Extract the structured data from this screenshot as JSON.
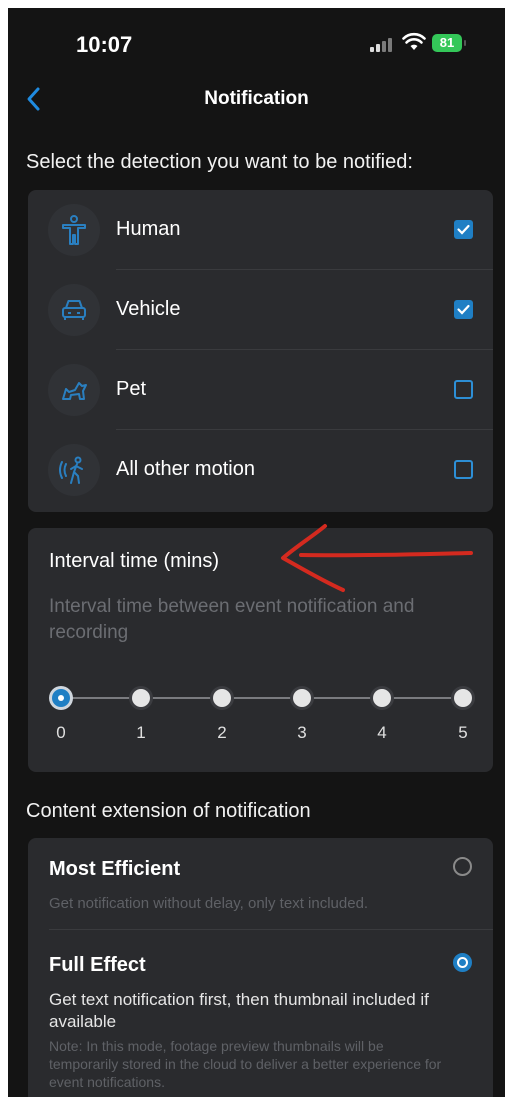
{
  "status_bar": {
    "time": "10:07",
    "battery": "81"
  },
  "nav": {
    "title": "Notification"
  },
  "detection": {
    "heading": "Select the detection you want to be notified:",
    "items": [
      {
        "label": "Human",
        "checked": true,
        "icon": "person-icon"
      },
      {
        "label": "Vehicle",
        "checked": true,
        "icon": "car-icon"
      },
      {
        "label": "Pet",
        "checked": false,
        "icon": "pet-icon"
      },
      {
        "label": "All other motion",
        "checked": false,
        "icon": "motion-icon"
      }
    ]
  },
  "interval": {
    "title": "Interval time (mins)",
    "description": "Interval time between event notification and recording",
    "options": [
      "0",
      "1",
      "2",
      "3",
      "4",
      "5"
    ],
    "selected": "0"
  },
  "content_extension": {
    "heading": "Content extension of notification",
    "options": [
      {
        "title": "Most Efficient",
        "description": "Get notification without delay, only text included.",
        "selected": false
      },
      {
        "title": "Full Effect",
        "description": "Get text notification first, then thumbnail included if available",
        "note": "Note: In this mode, footage preview thumbnails will be temporarily stored in the cloud to deliver a better experience for event notifications.",
        "selected": true
      }
    ]
  },
  "colors": {
    "accent": "#1f7fc4",
    "annotation": "#d42a1f",
    "background": "#141414",
    "card": "#2a2b2e"
  }
}
